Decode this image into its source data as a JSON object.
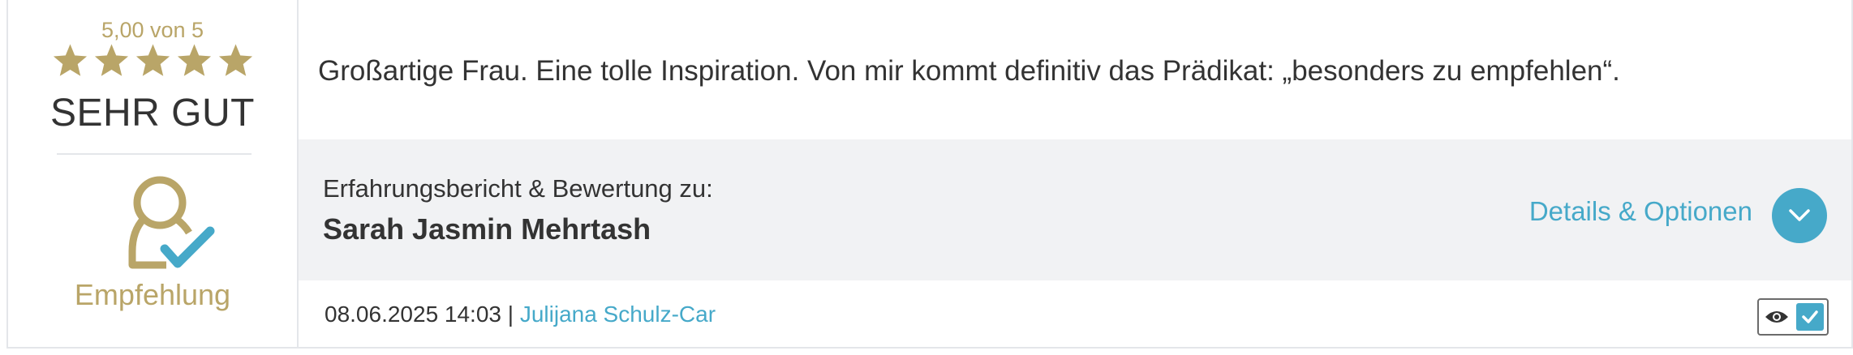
{
  "rating": {
    "score_text": "5,00 von 5",
    "stars": 5,
    "max_stars": 5,
    "label": "SEHR GUT"
  },
  "recommendation": {
    "label": "Empfehlung"
  },
  "review": {
    "text": "Großartige Frau. Eine tolle Inspiration. Von mir kommt definitiv das Prädikat: „besonders zu empfehlen“."
  },
  "subject": {
    "label": "Erfahrungsbericht & Bewertung zu:",
    "name": "Sarah Jasmin Mehrtash"
  },
  "details": {
    "link_label": "Details & Optionen"
  },
  "meta": {
    "date": "08.06.2025 14:03",
    "separator": " | ",
    "author": "Julijana Schulz-Car"
  },
  "colors": {
    "gold": "#b9a568",
    "accent": "#46a9c9",
    "panel": "#f1f2f4"
  }
}
